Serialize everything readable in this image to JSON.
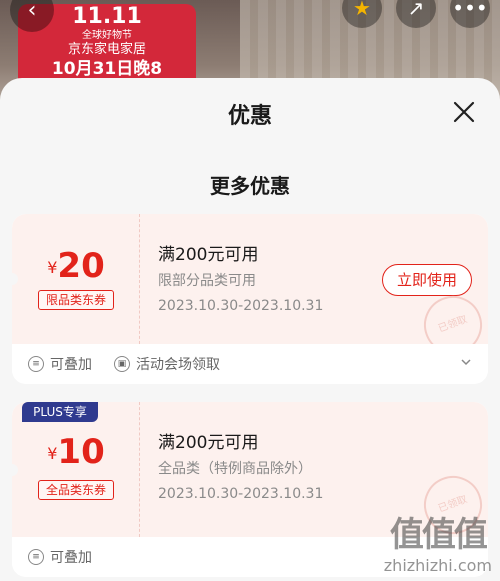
{
  "background": {
    "promo": {
      "line1": "11.11",
      "line2": "全球好物节",
      "line3": "京东家电家居",
      "line4": "10月31日晚8"
    }
  },
  "sheet": {
    "title": "优惠",
    "section_title": "更多优惠"
  },
  "coupons": [
    {
      "currency": "¥",
      "amount": "20",
      "type": "限品类东券",
      "condition": "满200元可用",
      "scope": "限部分品类可用",
      "date": "2023.10.30-2023.10.31",
      "action": "立即使用",
      "stamp": "已领取",
      "footer": [
        "可叠加",
        "活动会场领取"
      ]
    },
    {
      "badge": "PLUS专享",
      "currency": "¥",
      "amount": "10",
      "type": "全品类东券",
      "condition": "满200元可用",
      "scope": "全品类（特例商品除外）",
      "date": "2023.10.30-2023.10.31",
      "stamp": "已领取",
      "footer": [
        "可叠加"
      ]
    }
  ],
  "watermark": {
    "logo": "值值值",
    "url": "zhizhizhi.com"
  },
  "colors": {
    "accent": "#e2231a",
    "plus": "#2f3a8f",
    "promo": "#d3283a"
  }
}
